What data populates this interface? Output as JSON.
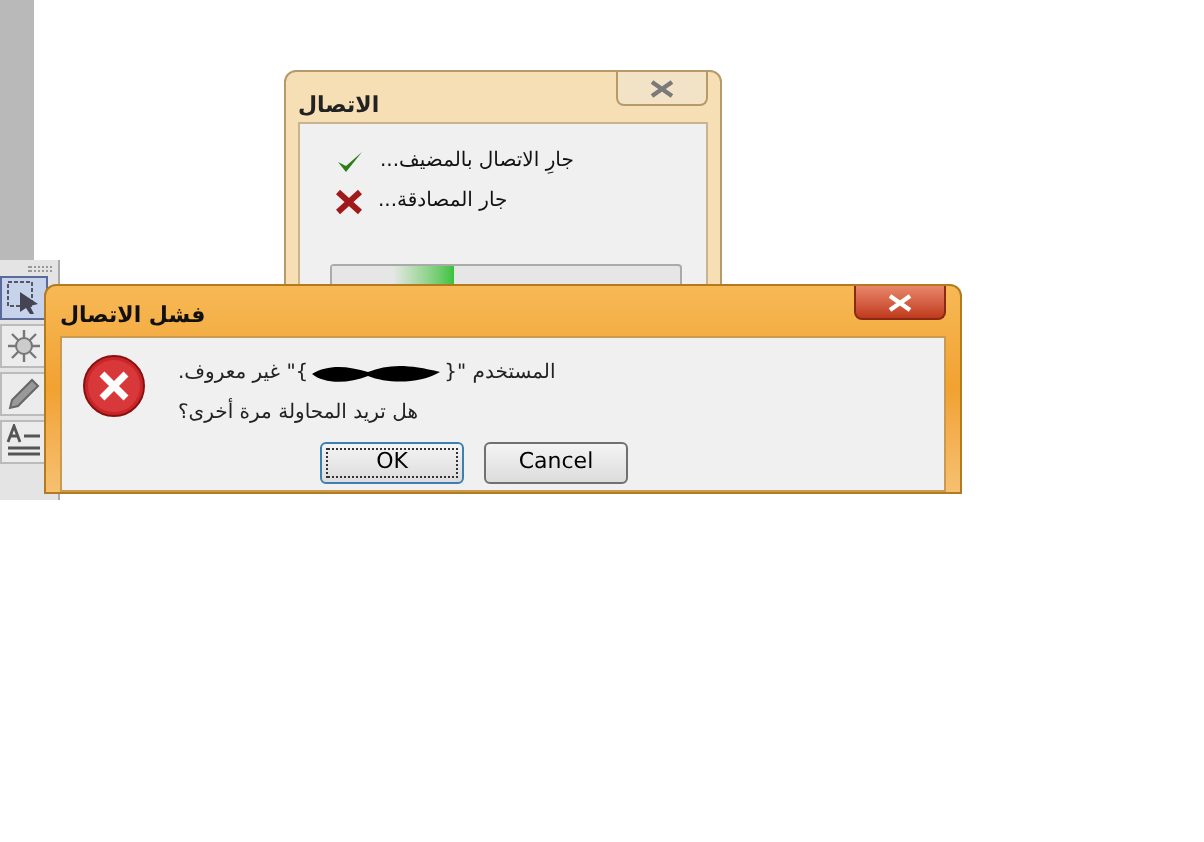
{
  "back_dialog": {
    "title": "الاتصال",
    "steps": [
      {
        "label": "جارِ الاتصال بالمضيف...",
        "kind": "done"
      },
      {
        "label": "جار المصادقة...",
        "kind": "failed"
      }
    ],
    "progress": {
      "level": 0.35
    }
  },
  "toolbox": {
    "tools": [
      {
        "kind": "select",
        "selected": true
      },
      {
        "kind": "burst",
        "selected": false
      },
      {
        "kind": "pencil",
        "selected": false
      },
      {
        "kind": "text",
        "selected": false
      }
    ]
  },
  "error_dialog": {
    "title": "فشل الاتصال",
    "message_start": "المستخدم \"{",
    "message_end": "}\" غير معروف.",
    "question": "هل تريد المحاولة مرة أخرى؟",
    "buttons": [
      {
        "label": "Cancel",
        "selected": false
      },
      {
        "label": "OK",
        "selected": true
      }
    ]
  }
}
